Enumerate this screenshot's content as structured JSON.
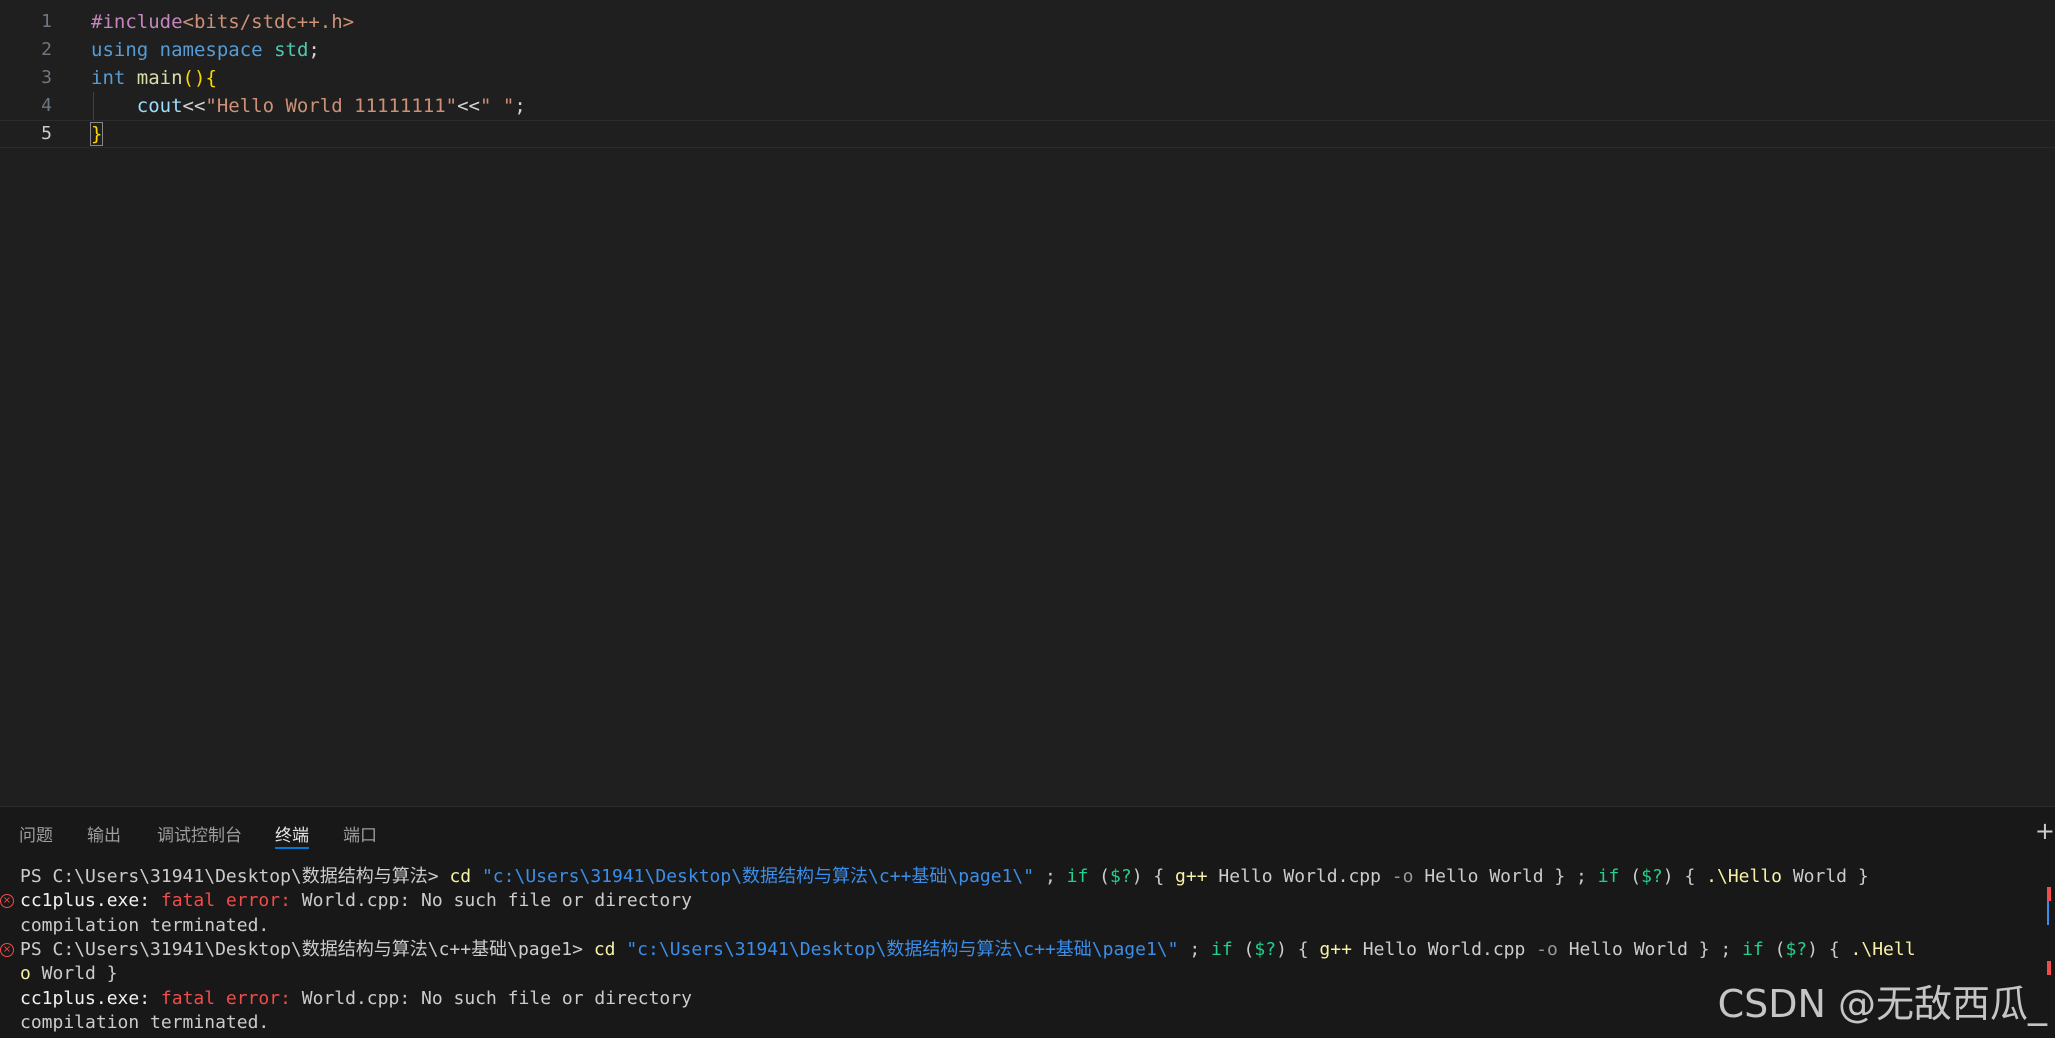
{
  "editor": {
    "lines": [
      {
        "num": "1",
        "parts": [
          {
            "t": "#include",
            "c": "tok-dir"
          },
          {
            "t": "<bits/stdc++.h>",
            "c": "tok-inc"
          }
        ]
      },
      {
        "num": "2",
        "parts": [
          {
            "t": "using",
            "c": "tok-kw"
          },
          {
            "t": " ",
            "c": "tok-pl"
          },
          {
            "t": "namespace",
            "c": "tok-kw"
          },
          {
            "t": " ",
            "c": "tok-pl"
          },
          {
            "t": "std",
            "c": "tok-type"
          },
          {
            "t": ";",
            "c": "tok-pl"
          }
        ]
      },
      {
        "num": "3",
        "parts": [
          {
            "t": "int",
            "c": "tok-kw"
          },
          {
            "t": " ",
            "c": "tok-pl"
          },
          {
            "t": "main",
            "c": "tok-fn"
          },
          {
            "t": "()",
            "c": "tok-br"
          },
          {
            "t": "{",
            "c": "tok-br"
          }
        ]
      },
      {
        "num": "4",
        "parts": [
          {
            "t": "    ",
            "c": "tok-pl"
          },
          {
            "t": "cout",
            "c": "tok-var"
          },
          {
            "t": "<<",
            "c": "tok-pl"
          },
          {
            "t": "\"Hello World 11111111\"",
            "c": "tok-str"
          },
          {
            "t": "<<",
            "c": "tok-pl"
          },
          {
            "t": "\" \"",
            "c": "tok-str"
          },
          {
            "t": ";",
            "c": "tok-pl"
          }
        ]
      },
      {
        "num": "5",
        "parts": [
          {
            "t": "}",
            "c": "tok-br bracket-match"
          }
        ]
      }
    ]
  },
  "panel": {
    "tabs": [
      "问题",
      "输出",
      "调试控制台",
      "终端",
      "端口"
    ],
    "active_tab": "终端",
    "plus": "+"
  },
  "terminal": {
    "lines": [
      {
        "err": false,
        "parts": [
          {
            "t": "PS C:\\Users\\31941\\Desktop\\数据结构与算法> ",
            "c": ""
          },
          {
            "t": "cd",
            "c": "t-cmd"
          },
          {
            "t": " ",
            "c": ""
          },
          {
            "t": "\"c:\\Users\\31941\\Desktop\\数据结构与算法\\c++基础\\page1\\\"",
            "c": "t-path"
          },
          {
            "t": " ; ",
            "c": ""
          },
          {
            "t": "if",
            "c": "t-op"
          },
          {
            "t": " (",
            "c": ""
          },
          {
            "t": "$?",
            "c": "t-op"
          },
          {
            "t": ") { ",
            "c": ""
          },
          {
            "t": "g++",
            "c": "t-cmd"
          },
          {
            "t": " Hello World.cpp ",
            "c": ""
          },
          {
            "t": "-o",
            "c": "t-dim"
          },
          {
            "t": " Hello World } ; ",
            "c": ""
          },
          {
            "t": "if",
            "c": "t-op"
          },
          {
            "t": " (",
            "c": ""
          },
          {
            "t": "$?",
            "c": "t-op"
          },
          {
            "t": ") { ",
            "c": ""
          },
          {
            "t": ".\\Hello",
            "c": "t-cmd"
          },
          {
            "t": " World }",
            "c": ""
          }
        ]
      },
      {
        "err": true,
        "parts": [
          {
            "t": "cc1plus.exe: ",
            "c": "t-bold"
          },
          {
            "t": "fatal error: ",
            "c": "t-err"
          },
          {
            "t": "World.cpp: No such file or directory",
            "c": ""
          }
        ]
      },
      {
        "err": false,
        "parts": [
          {
            "t": "compilation terminated.",
            "c": ""
          }
        ]
      },
      {
        "err": true,
        "parts": [
          {
            "t": "PS C:\\Users\\31941\\Desktop\\数据结构与算法\\c++基础\\page1> ",
            "c": ""
          },
          {
            "t": "cd",
            "c": "t-cmd"
          },
          {
            "t": " ",
            "c": ""
          },
          {
            "t": "\"c:\\Users\\31941\\Desktop\\数据结构与算法\\c++基础\\page1\\\"",
            "c": "t-path"
          },
          {
            "t": " ; ",
            "c": ""
          },
          {
            "t": "if",
            "c": "t-op"
          },
          {
            "t": " (",
            "c": ""
          },
          {
            "t": "$?",
            "c": "t-op"
          },
          {
            "t": ") { ",
            "c": ""
          },
          {
            "t": "g++",
            "c": "t-cmd"
          },
          {
            "t": " Hello World.cpp ",
            "c": ""
          },
          {
            "t": "-o",
            "c": "t-dim"
          },
          {
            "t": " Hello World } ; ",
            "c": ""
          },
          {
            "t": "if",
            "c": "t-op"
          },
          {
            "t": " (",
            "c": ""
          },
          {
            "t": "$?",
            "c": "t-op"
          },
          {
            "t": ") { ",
            "c": ""
          },
          {
            "t": ".\\Hell",
            "c": "t-cmd"
          }
        ]
      },
      {
        "err": false,
        "parts": [
          {
            "t": "o",
            "c": "t-cmd"
          },
          {
            "t": " World }",
            "c": ""
          }
        ]
      },
      {
        "err": false,
        "parts": [
          {
            "t": "cc1plus.exe: ",
            "c": "t-bold"
          },
          {
            "t": "fatal error: ",
            "c": "t-err"
          },
          {
            "t": "World.cpp: No such file or directory",
            "c": ""
          }
        ]
      },
      {
        "err": false,
        "parts": [
          {
            "t": "compilation terminated.",
            "c": ""
          }
        ]
      }
    ]
  },
  "watermark": "CSDN @无敌西瓜_",
  "colors": {
    "editor_bg": "#1f1f1f",
    "panel_bg": "#181818",
    "accent": "#0078d4",
    "error": "#f14c4c"
  }
}
